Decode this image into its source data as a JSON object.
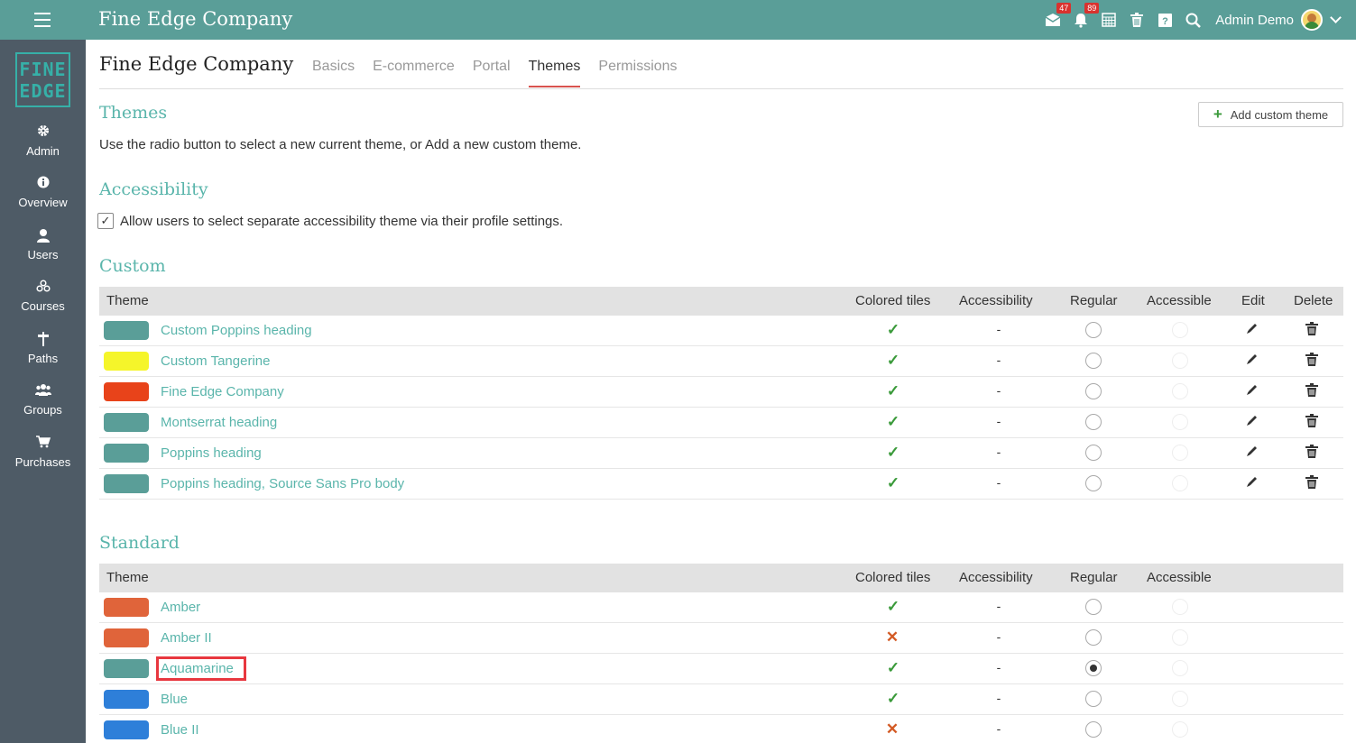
{
  "topbar": {
    "app_title": "Fine Edge Company",
    "inbox_badge": "47",
    "notifications_badge": "89",
    "user_name": "Admin Demo"
  },
  "sidebar": {
    "logo_line1": "FINE",
    "logo_line2": "EDGE",
    "items": [
      {
        "label": "Admin",
        "icon": "gear-icon"
      },
      {
        "label": "Overview",
        "icon": "info-icon"
      },
      {
        "label": "Users",
        "icon": "user-icon"
      },
      {
        "label": "Courses",
        "icon": "courses-icon"
      },
      {
        "label": "Paths",
        "icon": "signpost-icon"
      },
      {
        "label": "Groups",
        "icon": "group-icon"
      },
      {
        "label": "Purchases",
        "icon": "cart-icon"
      }
    ]
  },
  "page": {
    "title": "Fine Edge Company",
    "tabs": [
      "Basics",
      "E-commerce",
      "Portal",
      "Themes",
      "Permissions"
    ],
    "active_tab": "Themes"
  },
  "themes": {
    "heading": "Themes",
    "description": "Use the radio button to select a new current theme, or Add a new custom theme.",
    "add_button": "Add custom theme"
  },
  "accessibility": {
    "heading": "Accessibility",
    "checkbox_label": "Allow users to select separate accessibility theme via their profile settings.",
    "checked": true
  },
  "custom": {
    "heading": "Custom",
    "columns": [
      "Theme",
      "Colored tiles",
      "Accessibility",
      "Regular",
      "Accessible",
      "Edit",
      "Delete"
    ],
    "rows": [
      {
        "name": "Custom Poppins heading",
        "color": "#5a9e98",
        "colored_tiles": true,
        "accessibility": "-",
        "regular": false
      },
      {
        "name": "Custom Tangerine",
        "color": "#f5f52a",
        "colored_tiles": true,
        "accessibility": "-",
        "regular": false
      },
      {
        "name": "Fine Edge Company",
        "color": "#e8431a",
        "colored_tiles": true,
        "accessibility": "-",
        "regular": false
      },
      {
        "name": "Montserrat heading",
        "color": "#5a9e98",
        "colored_tiles": true,
        "accessibility": "-",
        "regular": false
      },
      {
        "name": "Poppins heading",
        "color": "#5a9e98",
        "colored_tiles": true,
        "accessibility": "-",
        "regular": false
      },
      {
        "name": "Poppins heading, Source Sans Pro body",
        "color": "#5a9e98",
        "colored_tiles": true,
        "accessibility": "-",
        "regular": false
      }
    ]
  },
  "standard": {
    "heading": "Standard",
    "columns": [
      "Theme",
      "Colored tiles",
      "Accessibility",
      "Regular",
      "Accessible"
    ],
    "rows": [
      {
        "name": "Amber",
        "color": "#e0643a",
        "colored_tiles": true,
        "accessibility": "-",
        "regular": false
      },
      {
        "name": "Amber II",
        "color": "#e0643a",
        "colored_tiles": false,
        "accessibility": "-",
        "regular": false
      },
      {
        "name": "Aquamarine",
        "color": "#5a9e98",
        "colored_tiles": true,
        "accessibility": "-",
        "regular": true
      },
      {
        "name": "Blue",
        "color": "#2e7fd9",
        "colored_tiles": true,
        "accessibility": "-",
        "regular": false
      },
      {
        "name": "Blue II",
        "color": "#2e7fd9",
        "colored_tiles": false,
        "accessibility": "-",
        "regular": false
      }
    ]
  }
}
